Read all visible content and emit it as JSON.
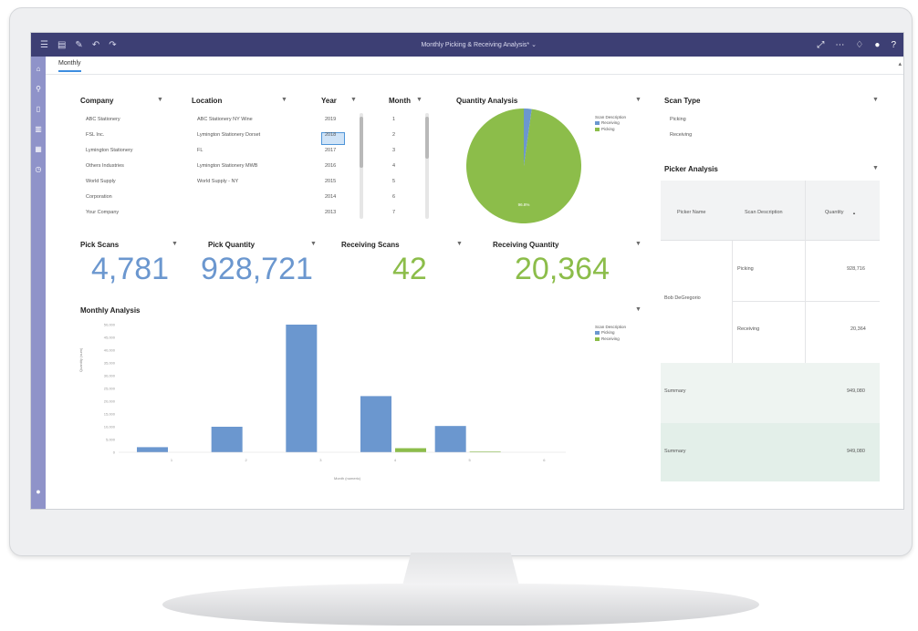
{
  "topbar": {
    "title": "Monthly Picking & Receiving Analysis* ⌄",
    "icons_left": [
      "menu-icon",
      "folder-icon",
      "pencil-icon",
      "undo-icon",
      "redo-icon"
    ],
    "icons_right": [
      "expand-icon",
      "more-icon",
      "bell-icon",
      "user-icon",
      "help-icon"
    ]
  },
  "tab": {
    "label": "Monthly"
  },
  "company": {
    "title": "Company",
    "items": [
      "ABC Stationery",
      "FSL Inc.",
      "Lymington Stationery",
      "Others Industries",
      "World Supply",
      "Corporation",
      "Your Company"
    ]
  },
  "location": {
    "title": "Location",
    "items": [
      "ABC Stationery NY Wine",
      "Lymington Stationery Dorset",
      "FL",
      "Lymington Stationery MWB",
      "World Supply - NY"
    ]
  },
  "year": {
    "title": "Year",
    "items": [
      "2019",
      "2018",
      "2017",
      "2016",
      "2015",
      "2014",
      "2013"
    ],
    "selected_index": 1
  },
  "month": {
    "title": "Month",
    "items": [
      "1",
      "2",
      "3",
      "4",
      "5",
      "6",
      "7"
    ]
  },
  "quantity_analysis": {
    "title": "Quantity Analysis",
    "legend_title": "Scan Description",
    "legend": [
      "Receiving",
      "Picking"
    ],
    "slice_label": "96.8%",
    "chart_data": {
      "type": "pie",
      "labels": [
        "Receiving",
        "Picking"
      ],
      "values": [
        2.2,
        97.8
      ]
    }
  },
  "scan_type": {
    "title": "Scan Type",
    "items": [
      "Picking",
      "Receiving"
    ]
  },
  "kpis": [
    {
      "title": "Pick Scans",
      "value": "4,781",
      "color": "#6b97cf"
    },
    {
      "title": "Pick Quantity",
      "value": "928,721",
      "color": "#6b97cf"
    },
    {
      "title": "Receiving Scans",
      "value": "42",
      "color": "#8cbd4a"
    },
    {
      "title": "Receiving Quantity",
      "value": "20,364",
      "color": "#8cbd4a"
    }
  ],
  "monthly_analysis": {
    "title": "Monthly Analysis",
    "ylabel": "Quantity (sum)",
    "xlabel": "Month (numeric)",
    "legend_title": "Scan Description",
    "legend": [
      "Picking",
      "Receiving"
    ],
    "y_ticks": [
      "50,000",
      "45,000",
      "40,000",
      "35,000",
      "30,000",
      "25,000",
      "20,000",
      "15,000",
      "10,000",
      "5,000",
      "0"
    ],
    "x_ticks": [
      "1",
      "2",
      "3",
      "4",
      "5",
      "6"
    ],
    "chart_data": {
      "type": "bar",
      "categories": [
        "1",
        "2",
        "3",
        "4",
        "5",
        "6"
      ],
      "series": [
        {
          "name": "Picking",
          "values": [
            2000,
            10000,
            50000,
            22000,
            10300,
            0
          ]
        },
        {
          "name": "Receiving",
          "values": [
            0,
            0,
            0,
            1600,
            300,
            0
          ]
        }
      ],
      "ylim": [
        0,
        50000
      ]
    }
  },
  "picker_analysis": {
    "title": "Picker Analysis",
    "columns": [
      "Picker Name",
      "Scan Description",
      "Quantity"
    ],
    "sort_icon": "▲",
    "picker_name": "Bob DeGregorio",
    "rows": [
      {
        "desc": "Picking",
        "qty": "928,716"
      },
      {
        "desc": "Receiving",
        "qty": "20,364"
      }
    ],
    "summaries": [
      {
        "label": "Summary",
        "qty": "949,080"
      },
      {
        "label": "Summary",
        "qty": "949,080"
      }
    ]
  },
  "colors": {
    "blue": "#6b97cf",
    "green": "#8cbd4a",
    "topbar": "#3d3f74",
    "sidebar": "#8f93c9"
  }
}
